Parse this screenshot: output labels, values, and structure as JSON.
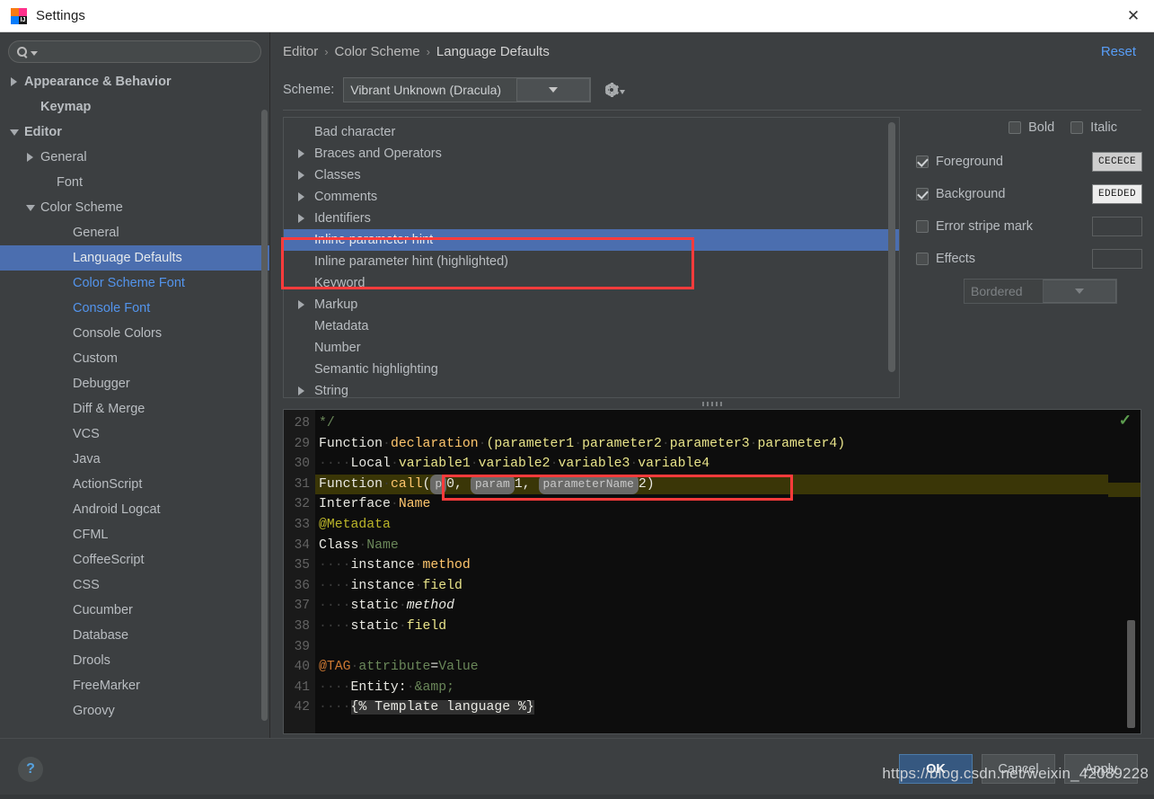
{
  "window": {
    "title": "Settings",
    "close_label": "✕",
    "logo_letters": "IJ"
  },
  "sidebar": {
    "search": {
      "placeholder": "",
      "value": "",
      "icon": "search-icon"
    },
    "items": [
      {
        "label": "Appearance & Behavior",
        "indent": 0,
        "twisty": "right",
        "style": "bold"
      },
      {
        "label": "Keymap",
        "indent": 1,
        "twisty": "none",
        "style": "bold"
      },
      {
        "label": "Editor",
        "indent": 0,
        "twisty": "down",
        "style": "bold"
      },
      {
        "label": "General",
        "indent": 1,
        "twisty": "right",
        "style": "normal"
      },
      {
        "label": "Font",
        "indent": 2,
        "twisty": "none",
        "style": "normal"
      },
      {
        "label": "Color Scheme",
        "indent": 1,
        "twisty": "down",
        "style": "normal"
      },
      {
        "label": "General",
        "indent": 3,
        "twisty": "none",
        "style": "normal"
      },
      {
        "label": "Language Defaults",
        "indent": 3,
        "twisty": "none",
        "style": "selected"
      },
      {
        "label": "Color Scheme Font",
        "indent": 3,
        "twisty": "none",
        "style": "blue"
      },
      {
        "label": "Console Font",
        "indent": 3,
        "twisty": "none",
        "style": "blue"
      },
      {
        "label": "Console Colors",
        "indent": 3,
        "twisty": "none",
        "style": "normal"
      },
      {
        "label": "Custom",
        "indent": 3,
        "twisty": "none",
        "style": "normal"
      },
      {
        "label": "Debugger",
        "indent": 3,
        "twisty": "none",
        "style": "normal"
      },
      {
        "label": "Diff & Merge",
        "indent": 3,
        "twisty": "none",
        "style": "normal"
      },
      {
        "label": "VCS",
        "indent": 3,
        "twisty": "none",
        "style": "normal"
      },
      {
        "label": "Java",
        "indent": 3,
        "twisty": "none",
        "style": "normal"
      },
      {
        "label": "ActionScript",
        "indent": 3,
        "twisty": "none",
        "style": "normal"
      },
      {
        "label": "Android Logcat",
        "indent": 3,
        "twisty": "none",
        "style": "normal"
      },
      {
        "label": "CFML",
        "indent": 3,
        "twisty": "none",
        "style": "normal"
      },
      {
        "label": "CoffeeScript",
        "indent": 3,
        "twisty": "none",
        "style": "normal"
      },
      {
        "label": "CSS",
        "indent": 3,
        "twisty": "none",
        "style": "normal"
      },
      {
        "label": "Cucumber",
        "indent": 3,
        "twisty": "none",
        "style": "normal"
      },
      {
        "label": "Database",
        "indent": 3,
        "twisty": "none",
        "style": "normal"
      },
      {
        "label": "Drools",
        "indent": 3,
        "twisty": "none",
        "style": "normal"
      },
      {
        "label": "FreeMarker",
        "indent": 3,
        "twisty": "none",
        "style": "normal"
      },
      {
        "label": "Groovy",
        "indent": 3,
        "twisty": "none",
        "style": "normal"
      }
    ]
  },
  "breadcrumb": {
    "parts": [
      "Editor",
      "Color Scheme",
      "Language Defaults"
    ],
    "separator": "›",
    "reset_label": "Reset"
  },
  "scheme": {
    "label": "Scheme:",
    "value": "Vibrant Unknown (Dracula)",
    "gear_icon": "gear-icon"
  },
  "scheme_list": [
    {
      "label": "Bad character",
      "expandable": false,
      "selected": false
    },
    {
      "label": "Braces and Operators",
      "expandable": true,
      "selected": false
    },
    {
      "label": "Classes",
      "expandable": true,
      "selected": false
    },
    {
      "label": "Comments",
      "expandable": true,
      "selected": false
    },
    {
      "label": "Identifiers",
      "expandable": true,
      "selected": false
    },
    {
      "label": "Inline parameter hint",
      "expandable": false,
      "selected": true
    },
    {
      "label": "Inline parameter hint (highlighted)",
      "expandable": false,
      "selected": false
    },
    {
      "label": "Keyword",
      "expandable": false,
      "selected": false
    },
    {
      "label": "Markup",
      "expandable": true,
      "selected": false
    },
    {
      "label": "Metadata",
      "expandable": false,
      "selected": false
    },
    {
      "label": "Number",
      "expandable": false,
      "selected": false
    },
    {
      "label": "Semantic highlighting",
      "expandable": false,
      "selected": false
    },
    {
      "label": "String",
      "expandable": true,
      "selected": false
    }
  ],
  "attributes": {
    "bold": {
      "label": "Bold",
      "checked": false
    },
    "italic": {
      "label": "Italic",
      "checked": false
    },
    "rows": [
      {
        "label": "Foreground",
        "checked": true,
        "color": "CECECE",
        "swatch_bg": "#cecece",
        "swatch_fg": "#1a1a1a"
      },
      {
        "label": "Background",
        "checked": true,
        "color": "EDEDED",
        "swatch_bg": "#ededed",
        "swatch_fg": "#1a1a1a"
      },
      {
        "label": "Error stripe mark",
        "checked": false,
        "color": "",
        "swatch_bg": "",
        "swatch_fg": ""
      },
      {
        "label": "Effects",
        "checked": false,
        "color": "",
        "swatch_bg": "",
        "swatch_fg": ""
      }
    ],
    "effect_type": {
      "value": "Bordered",
      "disabled": true
    }
  },
  "preview": {
    "inspection_icon": "inspection-ok-icon",
    "lines": [
      {
        "num": "28",
        "segs": [
          {
            "t": " ",
            "c": "dot"
          },
          {
            "t": "*/",
            "c": "k-grn"
          }
        ]
      },
      {
        "num": "29",
        "segs": [
          {
            "t": "Function",
            "c": "k-white"
          },
          {
            "t": "·",
            "c": "dot"
          },
          {
            "t": "declaration",
            "c": "k-decl"
          },
          {
            "t": "·",
            "c": "dot"
          },
          {
            "t": "(parameter1",
            "c": "k-yel"
          },
          {
            "t": "·",
            "c": "dot"
          },
          {
            "t": "parameter2",
            "c": "k-yel"
          },
          {
            "t": "·",
            "c": "dot"
          },
          {
            "t": "parameter3",
            "c": "k-yel"
          },
          {
            "t": "·",
            "c": "dot"
          },
          {
            "t": "parameter4)",
            "c": "k-yel"
          }
        ]
      },
      {
        "num": "30",
        "segs": [
          {
            "t": "····",
            "c": "dot"
          },
          {
            "t": "Local",
            "c": "k-white"
          },
          {
            "t": "·",
            "c": "dot"
          },
          {
            "t": "variable1",
            "c": "k-yel"
          },
          {
            "t": "·",
            "c": "dot"
          },
          {
            "t": "variable2",
            "c": "k-yel"
          },
          {
            "t": "·",
            "c": "dot"
          },
          {
            "t": "variable3",
            "c": "k-yel"
          },
          {
            "t": "·",
            "c": "dot"
          },
          {
            "t": "variable4",
            "c": "k-yel"
          }
        ]
      },
      {
        "num": "31",
        "highlight": true,
        "segs": [
          {
            "t": "Function",
            "c": "k-white"
          },
          {
            "t": "·",
            "c": "dot"
          },
          {
            "t": "call",
            "c": "k-decl"
          },
          {
            "t": "(",
            "c": "k-white"
          },
          {
            "t": "p",
            "c": "hint"
          },
          {
            "t": "0,",
            "c": "k-white"
          },
          {
            "t": " ",
            "c": "k-white"
          },
          {
            "t": "param",
            "c": "hint"
          },
          {
            "t": "1,",
            "c": "k-white"
          },
          {
            "t": " ",
            "c": "k-white"
          },
          {
            "t": "parameterName",
            "c": "hint"
          },
          {
            "t": "2)",
            "c": "k-white"
          }
        ]
      },
      {
        "num": "32",
        "segs": [
          {
            "t": "Interface",
            "c": "k-white"
          },
          {
            "t": "·",
            "c": "dot"
          },
          {
            "t": "Name",
            "c": "k-decl"
          }
        ]
      },
      {
        "num": "33",
        "segs": [
          {
            "t": "@Metadata",
            "c": "k-meta"
          }
        ]
      },
      {
        "num": "34",
        "segs": [
          {
            "t": "Class",
            "c": "k-white"
          },
          {
            "t": "·",
            "c": "dot"
          },
          {
            "t": "Name",
            "c": "k-grn"
          }
        ]
      },
      {
        "num": "35",
        "segs": [
          {
            "t": "····",
            "c": "dot"
          },
          {
            "t": "instance",
            "c": "k-white"
          },
          {
            "t": "·",
            "c": "dot"
          },
          {
            "t": "method",
            "c": "k-decl"
          }
        ]
      },
      {
        "num": "36",
        "segs": [
          {
            "t": "····",
            "c": "dot"
          },
          {
            "t": "instance",
            "c": "k-white"
          },
          {
            "t": "·",
            "c": "dot"
          },
          {
            "t": "field",
            "c": "k-yel"
          }
        ]
      },
      {
        "num": "37",
        "segs": [
          {
            "t": "····",
            "c": "dot"
          },
          {
            "t": "static",
            "c": "k-white"
          },
          {
            "t": "·",
            "c": "dot"
          },
          {
            "t": "method",
            "c": "k-white k-ital"
          }
        ]
      },
      {
        "num": "38",
        "segs": [
          {
            "t": "····",
            "c": "dot"
          },
          {
            "t": "static",
            "c": "k-white"
          },
          {
            "t": "·",
            "c": "dot"
          },
          {
            "t": "field",
            "c": "k-yel"
          }
        ]
      },
      {
        "num": "39",
        "segs": []
      },
      {
        "num": "40",
        "segs": [
          {
            "t": "@TAG",
            "c": "k-orange"
          },
          {
            "t": "·",
            "c": "dot"
          },
          {
            "t": "attribute",
            "c": "k-grn"
          },
          {
            "t": "=",
            "c": "k-white"
          },
          {
            "t": "Value",
            "c": "k-grn"
          }
        ]
      },
      {
        "num": "41",
        "segs": [
          {
            "t": "····",
            "c": "dot"
          },
          {
            "t": "Entity:",
            "c": "k-white"
          },
          {
            "t": "·",
            "c": "dot"
          },
          {
            "t": "&amp;",
            "c": "k-grn"
          }
        ]
      },
      {
        "num": "42",
        "segs": [
          {
            "t": "····",
            "c": "dot"
          },
          {
            "t": "{% Template language %}",
            "c": "k-white tpl-bg"
          }
        ]
      }
    ]
  },
  "footer": {
    "help_label": "?",
    "ok_label": "OK",
    "cancel_label": "Cancel",
    "apply_label": "Apply"
  },
  "watermark": "https://blog.csdn.net/weixin_42089228",
  "colors": {
    "accent_selection": "#4b6eaf",
    "link": "#589df6",
    "annotation": "#ff3b3b",
    "panel_bg": "#3c3f41",
    "editor_bg": "#0d0d0d"
  }
}
